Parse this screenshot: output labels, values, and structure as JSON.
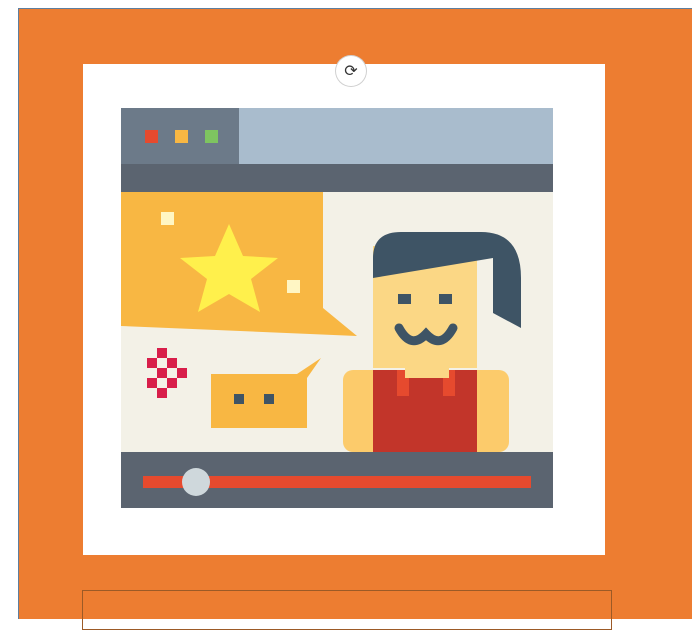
{
  "colors": {
    "frame": "#ed7d31",
    "card": "#ffffff",
    "browser_titlebar": "#a9bccd",
    "browser_tabs": "#6c7a89",
    "browser_bar": "#5b6470",
    "screen_bg": "#f3f1e7",
    "speech_yellow": "#f8b743",
    "star": "#fff04c",
    "progress_red": "#e64a2e",
    "hair": "#3e5465",
    "skin": "#fbd785",
    "shirt": "#c2352a",
    "shoulder": "#fccb6b"
  },
  "icons": {
    "rotate": "rotate-handle-icon",
    "illustration": "video-streamer-illustration-icon"
  },
  "player": {
    "progress": 0.14
  }
}
